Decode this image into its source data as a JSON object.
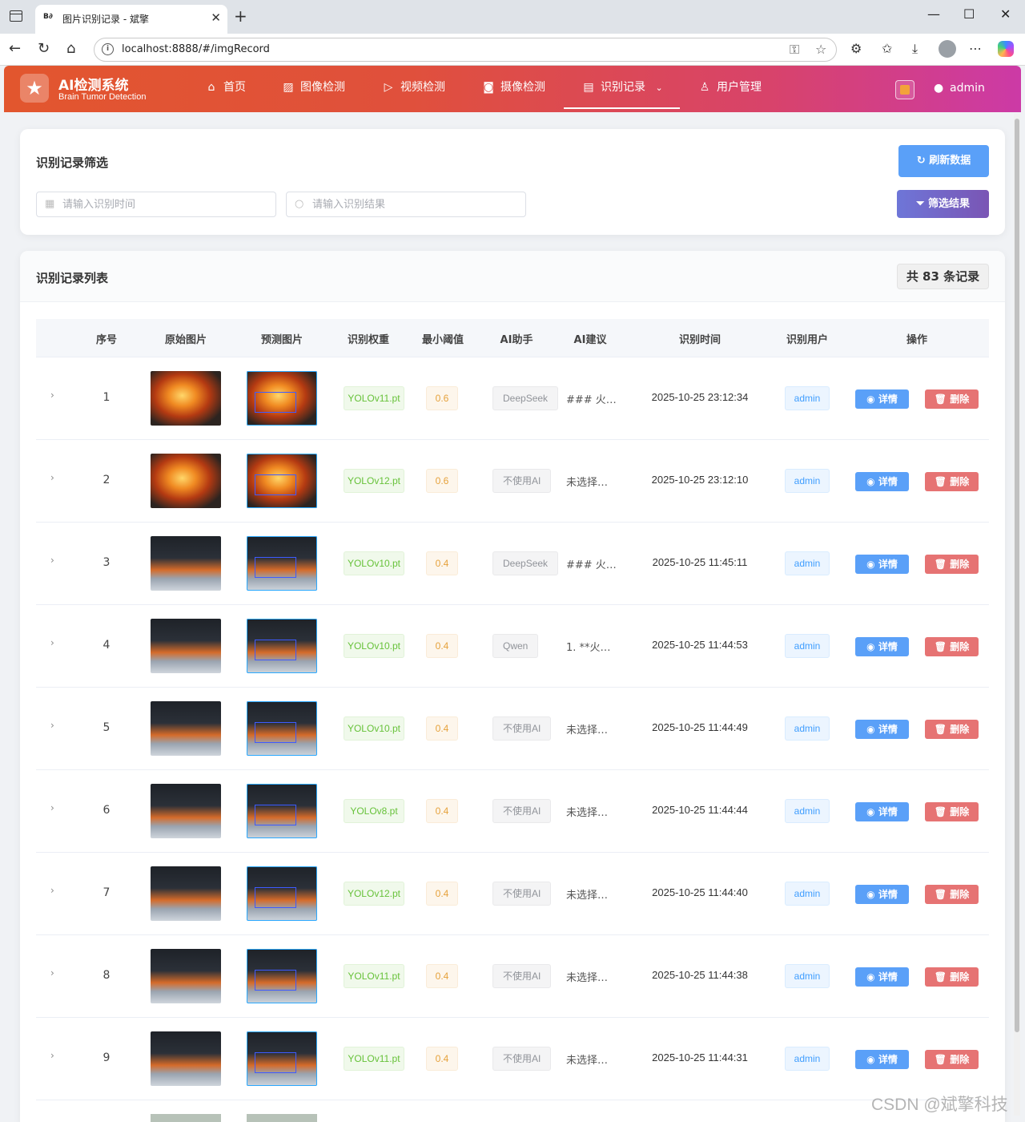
{
  "browser": {
    "tab_favicon": "B∂",
    "tab_title": "图片识别记录 - 斌擎",
    "url": "localhost:8888/#/imgRecord"
  },
  "app": {
    "logo_title": "AI检测系统",
    "logo_subtitle": "Brain Tumor Detection",
    "menu": [
      {
        "label": "首页",
        "icon": "home-icon"
      },
      {
        "label": "图像检测",
        "icon": "image-icon"
      },
      {
        "label": "视频检测",
        "icon": "play-circle-icon"
      },
      {
        "label": "摄像检测",
        "icon": "camera-icon"
      },
      {
        "label": "识别记录",
        "icon": "document-icon",
        "active": true
      },
      {
        "label": "用户管理",
        "icon": "user-icon"
      }
    ],
    "username": "admin",
    "accent_gradient": [
      "#e2562e",
      "#cc3aa6"
    ]
  },
  "filter": {
    "title": "识别记录筛选",
    "time_placeholder": "请输入识别时间",
    "result_placeholder": "请输入识别结果",
    "refresh_label": "刷新数据",
    "filter_label": "筛选结果"
  },
  "list": {
    "title": "识别记录列表",
    "count_label": "共 83 条记录",
    "columns": [
      "序号",
      "原始图片",
      "预测图片",
      "识别权重",
      "最小阈值",
      "AI助手",
      "AI建议",
      "识别时间",
      "识别用户",
      "操作"
    ],
    "detail_label": "详情",
    "delete_label": "删除",
    "rows": [
      {
        "index": "1",
        "image": "fire",
        "model": "YOLOv11.pt",
        "threshold": "0.6",
        "assistant": "DeepSeek",
        "advice": "### 火…",
        "time": "2025-10-25 23:12:34",
        "user": "admin"
      },
      {
        "index": "2",
        "image": "fire",
        "model": "YOLOv12.pt",
        "threshold": "0.6",
        "assistant": "不使用AI",
        "advice": "未选择…",
        "time": "2025-10-25 23:12:10",
        "user": "admin"
      },
      {
        "index": "3",
        "image": "smoke",
        "model": "YOLOv10.pt",
        "threshold": "0.4",
        "assistant": "DeepSeek",
        "advice": "### 火…",
        "time": "2025-10-25 11:45:11",
        "user": "admin"
      },
      {
        "index": "4",
        "image": "smoke",
        "model": "YOLOv10.pt",
        "threshold": "0.4",
        "assistant": "Qwen",
        "advice": "1. **火…",
        "time": "2025-10-25 11:44:53",
        "user": "admin"
      },
      {
        "index": "5",
        "image": "smoke",
        "model": "YOLOv10.pt",
        "threshold": "0.4",
        "assistant": "不使用AI",
        "advice": "未选择…",
        "time": "2025-10-25 11:44:49",
        "user": "admin"
      },
      {
        "index": "6",
        "image": "smoke",
        "model": "YOLOv8.pt",
        "threshold": "0.4",
        "assistant": "不使用AI",
        "advice": "未选择…",
        "time": "2025-10-25 11:44:44",
        "user": "admin"
      },
      {
        "index": "7",
        "image": "smoke",
        "model": "YOLOv12.pt",
        "threshold": "0.4",
        "assistant": "不使用AI",
        "advice": "未选择…",
        "time": "2025-10-25 11:44:40",
        "user": "admin"
      },
      {
        "index": "8",
        "image": "smoke",
        "model": "YOLOv11.pt",
        "threshold": "0.4",
        "assistant": "不使用AI",
        "advice": "未选择…",
        "time": "2025-10-25 11:44:38",
        "user": "admin"
      },
      {
        "index": "9",
        "image": "smoke",
        "model": "YOLOv11.pt",
        "threshold": "0.4",
        "assistant": "不使用AI",
        "advice": "未选择…",
        "time": "2025-10-25 11:44:31",
        "user": "admin"
      }
    ]
  },
  "watermark": "CSDN @斌擎科技"
}
